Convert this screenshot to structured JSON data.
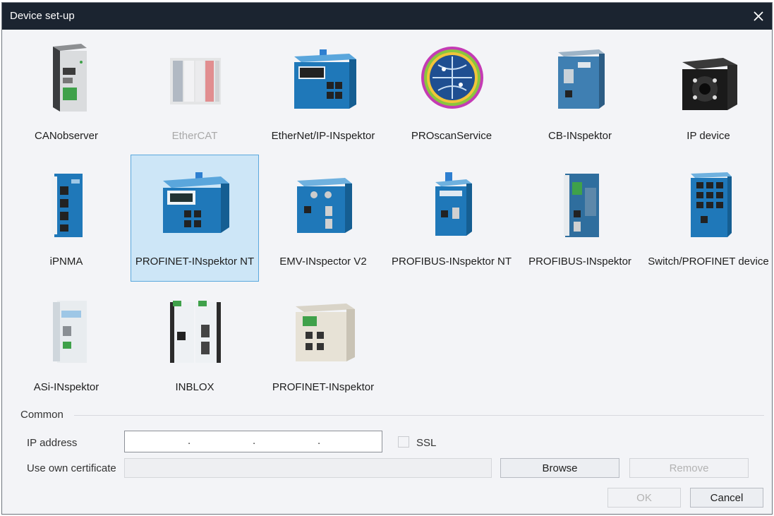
{
  "window": {
    "title": "Device set-up"
  },
  "devices": [
    {
      "label": "CANobserver",
      "icon": "canobserver-device-icon",
      "state": "normal"
    },
    {
      "label": "EtherCAT",
      "icon": "ethercat-device-icon",
      "state": "disabled"
    },
    {
      "label": "EtherNet/IP-INspektor",
      "icon": "ethernetip-inspektor-device-icon",
      "state": "normal"
    },
    {
      "label": "PROscanService",
      "icon": "proscanservice-globe-icon",
      "state": "normal"
    },
    {
      "label": "CB-INspektor",
      "icon": "cb-inspektor-device-icon",
      "state": "normal"
    },
    {
      "label": "IP device",
      "icon": "ip-device-camera-icon",
      "state": "normal"
    },
    {
      "label": "iPNMA",
      "icon": "ipnma-device-icon",
      "state": "normal"
    },
    {
      "label": "PROFINET-INspektor NT",
      "icon": "profinet-inspektor-nt-device-icon",
      "state": "selected"
    },
    {
      "label": "EMV-INspector V2",
      "icon": "emv-inspector-v2-device-icon",
      "state": "normal"
    },
    {
      "label": "PROFIBUS-INspektor NT",
      "icon": "profibus-inspektor-nt-device-icon",
      "state": "normal"
    },
    {
      "label": "PROFIBUS-INspektor",
      "icon": "profibus-inspektor-device-icon",
      "state": "normal"
    },
    {
      "label": "Switch/PROFINET device",
      "icon": "switch-profinet-device-icon",
      "state": "normal"
    },
    {
      "label": "ASi-INspektor",
      "icon": "asi-inspektor-device-icon",
      "state": "normal"
    },
    {
      "label": "INBLOX",
      "icon": "inblox-device-icon",
      "state": "normal"
    },
    {
      "label": "PROFINET-INspektor",
      "icon": "profinet-inspektor-device-icon",
      "state": "normal"
    }
  ],
  "common": {
    "section_label": "Common",
    "ip_label": "IP address",
    "ip_value": "",
    "ip_separators": [
      ".",
      ".",
      "."
    ],
    "ssl_label": "SSL",
    "ssl_checked": false,
    "cert_label": "Use own certificate",
    "cert_value": "",
    "browse_label": "Browse",
    "remove_label": "Remove"
  },
  "footer": {
    "ok_label": "OK",
    "cancel_label": "Cancel"
  },
  "colors": {
    "titlebar": "#1b2430",
    "selection": "#cde6f7",
    "selection_border": "#5aa8dd",
    "device_blue": "#1e7fc4"
  }
}
